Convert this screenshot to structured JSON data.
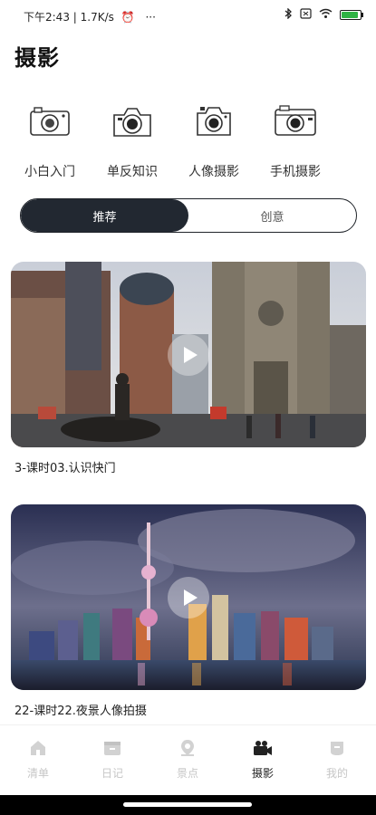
{
  "status_bar": {
    "left_text": "下午2:43 | 1.7K/s",
    "dots": "···",
    "battery_level": 0.8,
    "battery_color": "#2fb344"
  },
  "page": {
    "title": "摄影"
  },
  "categories": [
    {
      "label": "小白入门",
      "icon": "camera-outline-icon"
    },
    {
      "label": "单反知识",
      "icon": "dslr-camera-icon"
    },
    {
      "label": "人像摄影",
      "icon": "portrait-camera-icon"
    },
    {
      "label": "手机摄影",
      "icon": "instant-camera-icon"
    }
  ],
  "tabs": [
    {
      "label": "推荐",
      "active": true
    },
    {
      "label": "创意",
      "active": false
    }
  ],
  "videos": [
    {
      "title": "3-课时03.认识快门",
      "thumb": "cathedral-street-scene"
    },
    {
      "title": "22-课时22.夜景人像拍摄",
      "thumb": "shanghai-night-skyline"
    }
  ],
  "nav": [
    {
      "label": "清单",
      "icon": "home-icon",
      "active": false
    },
    {
      "label": "日记",
      "icon": "diary-icon",
      "active": false
    },
    {
      "label": "景点",
      "icon": "location-icon",
      "active": false
    },
    {
      "label": "摄影",
      "icon": "video-camera-icon",
      "active": true
    },
    {
      "label": "我的",
      "icon": "profile-icon",
      "active": false
    }
  ],
  "colors": {
    "accent_dark": "#222831",
    "nav_inactive": "#c6c6c6"
  }
}
